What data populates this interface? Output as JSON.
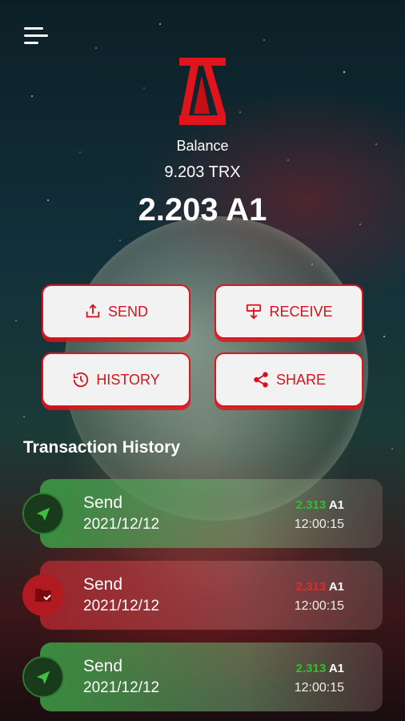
{
  "header": {
    "menu_icon": "hamburger-menu-icon"
  },
  "balance": {
    "label": "Balance",
    "trx": "9.203 TRX",
    "a1": "2.203 A1"
  },
  "actions": {
    "send": "SEND",
    "receive": "RECEIVE",
    "history": "HISTORY",
    "share": "SHARE"
  },
  "section_title": "Transaction History",
  "transactions": [
    {
      "type": "Send",
      "date": "2021/12/12",
      "amount": "2.313",
      "unit": "A1",
      "time": "12:00:15",
      "status": "green",
      "icon": "send-plane-icon"
    },
    {
      "type": "Send",
      "date": "2021/12/12",
      "amount": "2.313",
      "unit": "A1",
      "time": "12:00:15",
      "status": "red",
      "icon": "folder-receive-icon"
    },
    {
      "type": "Send",
      "date": "2021/12/12",
      "amount": "2.313",
      "unit": "A1",
      "time": "12:00:15",
      "status": "green",
      "icon": "send-plane-icon"
    }
  ],
  "colors": {
    "accent": "#e0141c",
    "success": "#2fbf2f",
    "danger": "#e32a2a"
  }
}
